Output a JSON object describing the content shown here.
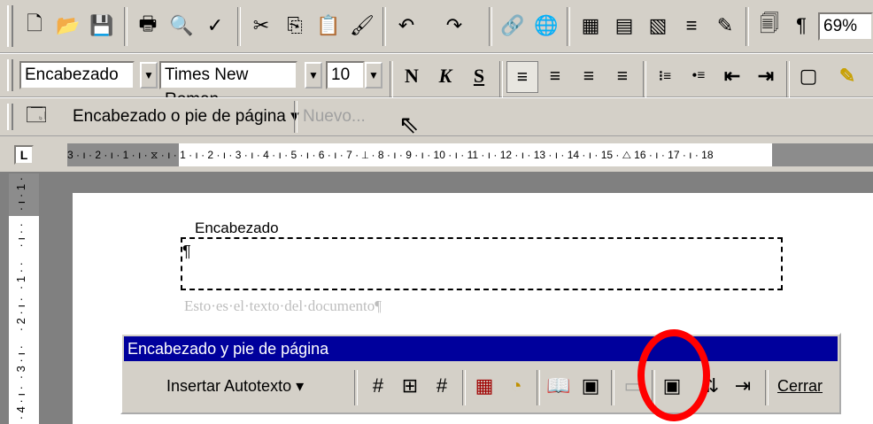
{
  "toolbar_standard": {
    "icons": [
      "new-doc-icon",
      "open-folder-icon",
      "save-icon",
      "print-icon",
      "print-preview-icon",
      "spell-check-icon",
      "cut-icon",
      "copy-icon",
      "paste-icon",
      "format-painter-icon",
      "undo-icon",
      "redo-icon",
      "hyperlink-icon",
      "web-icon",
      "tables-icon",
      "insert-table-icon",
      "excel-icon",
      "columns-icon",
      "drawing-icon",
      "doc-map-icon",
      "pilcrow-icon"
    ],
    "glyphs": [
      "🗋",
      "📂",
      "💾",
      "🖶",
      "🔍",
      "✓",
      "✂",
      "⎘",
      "📋",
      "🖌",
      "↶",
      "↷",
      "🔗",
      "🌐",
      "▦",
      "▤",
      "▧",
      "≡",
      "✎",
      "🗐",
      "¶"
    ],
    "zoom": "69%"
  },
  "toolbar_format": {
    "style": "Encabezado",
    "font": "Times New Roman",
    "size": "10",
    "bold": "N",
    "italic": "K",
    "underline": "S",
    "align_glyphs": [
      "≡",
      "≡",
      "≡",
      "≡"
    ],
    "list_glyphs": [
      "⁝≡",
      "•≡",
      "⇤",
      "⇥"
    ],
    "border_glyph": "▢",
    "highlight_glyph": "✎"
  },
  "toolbar_header": {
    "menu": "Encabezado o pie de página ▾",
    "nuevo": "Nuevo..."
  },
  "ruler": {
    "tab_glyph": "L",
    "text": "3 · ı · 2 · ı · 1 · ı · ⧖ · ı · 1 · ı · 2 · ı · 3 · ı · 4 · ı · 5 · ı · 6 · ı · 7 · ⊥ · 8 · ı · 9 · ı · 10 · ı · 11 · ı · 12 · ı · 13 · ı · 14 · ı · 15 · △ 16 · ı · 17 · ı · 18",
    "vticks": [
      "· ı · 1 ·",
      "· ı · ·",
      "· 1 · ·",
      "· 2 · ı ·",
      "· 3 · ı ·",
      "· 4 · ı ·"
    ]
  },
  "document": {
    "header_label": "Encabezado",
    "pilcrow": "¶",
    "body_text": "Esto·es·el·texto·del·documento¶"
  },
  "hf_toolbar": {
    "title": "Encabezado y pie de página",
    "insert_autotext": "Insertar Autotexto ▾",
    "glyphs": [
      "#",
      "⊞",
      "#",
      "▦",
      "◔",
      "📖",
      "▣",
      "▭",
      "▣",
      "⇅",
      "⇥"
    ],
    "icons": [
      "page-number-icon",
      "page-count-icon",
      "format-page-number-icon",
      "date-icon",
      "time-icon",
      "page-setup-icon",
      "show-hide-text-icon",
      "same-as-previous-icon",
      "switch-header-footer-icon",
      "show-previous-icon",
      "show-next-icon"
    ],
    "close": "Cerrar"
  }
}
